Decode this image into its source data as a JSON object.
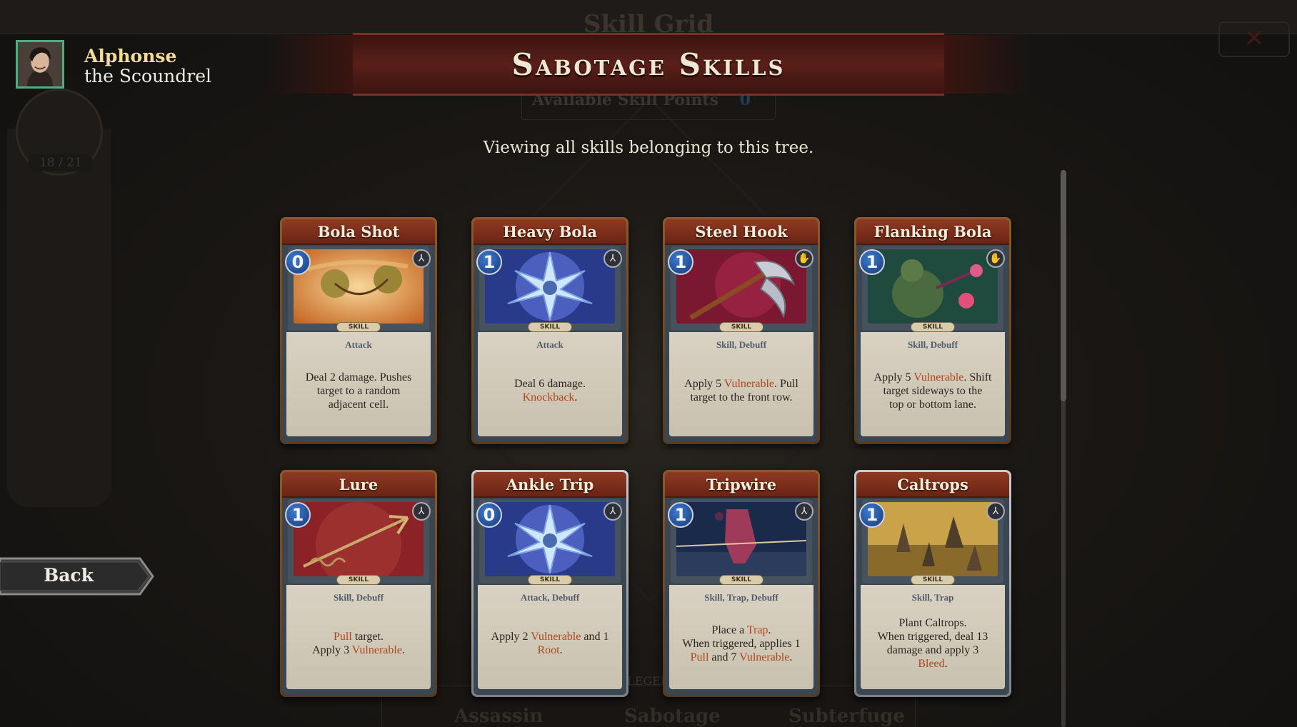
{
  "background": {
    "title": "Skill Grid",
    "points_label": "Available Skill Points",
    "points_value": "0",
    "avatar_count": "18 / 21",
    "close_glyph": "✕",
    "legend": "LEGEND",
    "tabs": [
      "Assassin",
      "Sabotage",
      "Subterfuge"
    ]
  },
  "header": {
    "title": "Sabotage Skills"
  },
  "subtitle": "Viewing all skills belonging to this tree.",
  "character": {
    "name": "Alphonse",
    "title": "the Scoundrel",
    "portrait_icon": "scoundrel-portrait"
  },
  "back_label": "Back",
  "skill_label": "SKILL",
  "colors": {
    "cost_blue": "#1f4f9c",
    "keyword": "#b0461d",
    "header_red": "#5a1f18",
    "portrait_border": "#4cae7d"
  },
  "cards": [
    {
      "name": "Bola Shot",
      "cost": "0",
      "tags": "Attack",
      "frame": "bronze",
      "type_icon": "archery-icon",
      "desc": [
        [
          {
            "t": "Deal 2 damage. Pushes"
          }
        ],
        [
          {
            "t": "target to a random"
          }
        ],
        [
          {
            "t": "adjacent cell."
          }
        ]
      ]
    },
    {
      "name": "Heavy Bola",
      "cost": "1",
      "tags": "Attack",
      "frame": "bronze",
      "type_icon": "archery-icon",
      "desc": [
        [
          {
            "t": "Deal 6 damage."
          }
        ],
        [
          {
            "t": "Knockback",
            "k": true
          },
          {
            "t": "."
          }
        ]
      ]
    },
    {
      "name": "Steel Hook",
      "cost": "1",
      "tags": "Skill, Debuff",
      "frame": "bronze",
      "type_icon": "hand-icon",
      "desc": [
        [
          {
            "t": "Apply 5 "
          },
          {
            "t": "Vulnerable",
            "k": true
          },
          {
            "t": ". Pull"
          }
        ],
        [
          {
            "t": "target to the front row."
          }
        ]
      ]
    },
    {
      "name": "Flanking Bola",
      "cost": "1",
      "tags": "Skill, Debuff",
      "frame": "bronze",
      "type_icon": "hand-icon",
      "desc": [
        [
          {
            "t": "Apply 5 "
          },
          {
            "t": "Vulnerable",
            "k": true
          },
          {
            "t": ". Shift"
          }
        ],
        [
          {
            "t": "target sideways to the"
          }
        ],
        [
          {
            "t": "top or bottom lane."
          }
        ]
      ]
    },
    {
      "name": "Lure",
      "cost": "1",
      "tags": "Skill, Debuff",
      "frame": "bronze",
      "type_icon": "archery-icon",
      "desc": [
        [
          {
            "t": "Pull",
            "k": true
          },
          {
            "t": " target."
          }
        ],
        [
          {
            "t": "Apply 3 "
          },
          {
            "t": "Vulnerable",
            "k": true
          },
          {
            "t": "."
          }
        ]
      ]
    },
    {
      "name": "Ankle Trip",
      "cost": "0",
      "tags": "Attack, Debuff",
      "frame": "silver",
      "type_icon": "archery-icon",
      "desc": [
        [
          {
            "t": "Apply 2 "
          },
          {
            "t": "Vulnerable",
            "k": true
          },
          {
            "t": " and 1"
          }
        ],
        [
          {
            "t": "Root",
            "k": true
          },
          {
            "t": "."
          }
        ]
      ]
    },
    {
      "name": "Tripwire",
      "cost": "1",
      "tags": "Skill, Trap, Debuff",
      "frame": "bronze",
      "type_icon": "archery-icon",
      "desc": [
        [
          {
            "t": "Place a "
          },
          {
            "t": "Trap",
            "k": true
          },
          {
            "t": "."
          }
        ],
        [
          {
            "t": "When triggered, applies 1"
          }
        ],
        [
          {
            "t": "Pull",
            "k": true
          },
          {
            "t": " and 7 "
          },
          {
            "t": "Vulnerable",
            "k": true
          },
          {
            "t": "."
          }
        ]
      ]
    },
    {
      "name": "Caltrops",
      "cost": "1",
      "tags": "Skill, Trap",
      "frame": "silver",
      "type_icon": "archery-icon",
      "desc": [
        [
          {
            "t": "Plant Caltrops."
          }
        ],
        [
          {
            "t": "When triggered, deal 13"
          }
        ],
        [
          {
            "t": "damage and apply 3"
          }
        ],
        [
          {
            "t": "Bleed",
            "k": true
          },
          {
            "t": "."
          }
        ]
      ]
    }
  ]
}
